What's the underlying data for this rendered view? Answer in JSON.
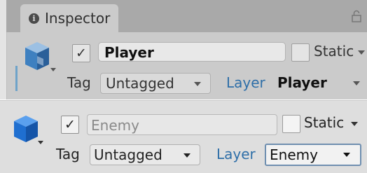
{
  "inspector": {
    "tab_icon": "info-icon",
    "tab_title": "Inspector",
    "lock_icon": "lock-icon"
  },
  "player": {
    "icon": "gameobject-cube-icon",
    "active_checked": true,
    "name": "Player",
    "static_label": "Static",
    "static_checked": false,
    "tag_label": "Tag",
    "tag_value": "Untagged",
    "layer_label": "Layer",
    "layer_value": "Player"
  },
  "enemy": {
    "icon": "gameobject-cube-icon",
    "active_checked": true,
    "name": "Enemy",
    "static_label": "Static",
    "static_checked": false,
    "tag_label": "Tag",
    "tag_value": "Untagged",
    "layer_label": "Layer",
    "layer_value": "Enemy"
  },
  "colors": {
    "cube_faded": "#3e80c0",
    "cube_bright": "#1f6fd0",
    "layer_label": "#2f6fa8",
    "tabbar": "#a9a9a9"
  },
  "glyphs": {
    "check": "✓",
    "info": "i"
  }
}
